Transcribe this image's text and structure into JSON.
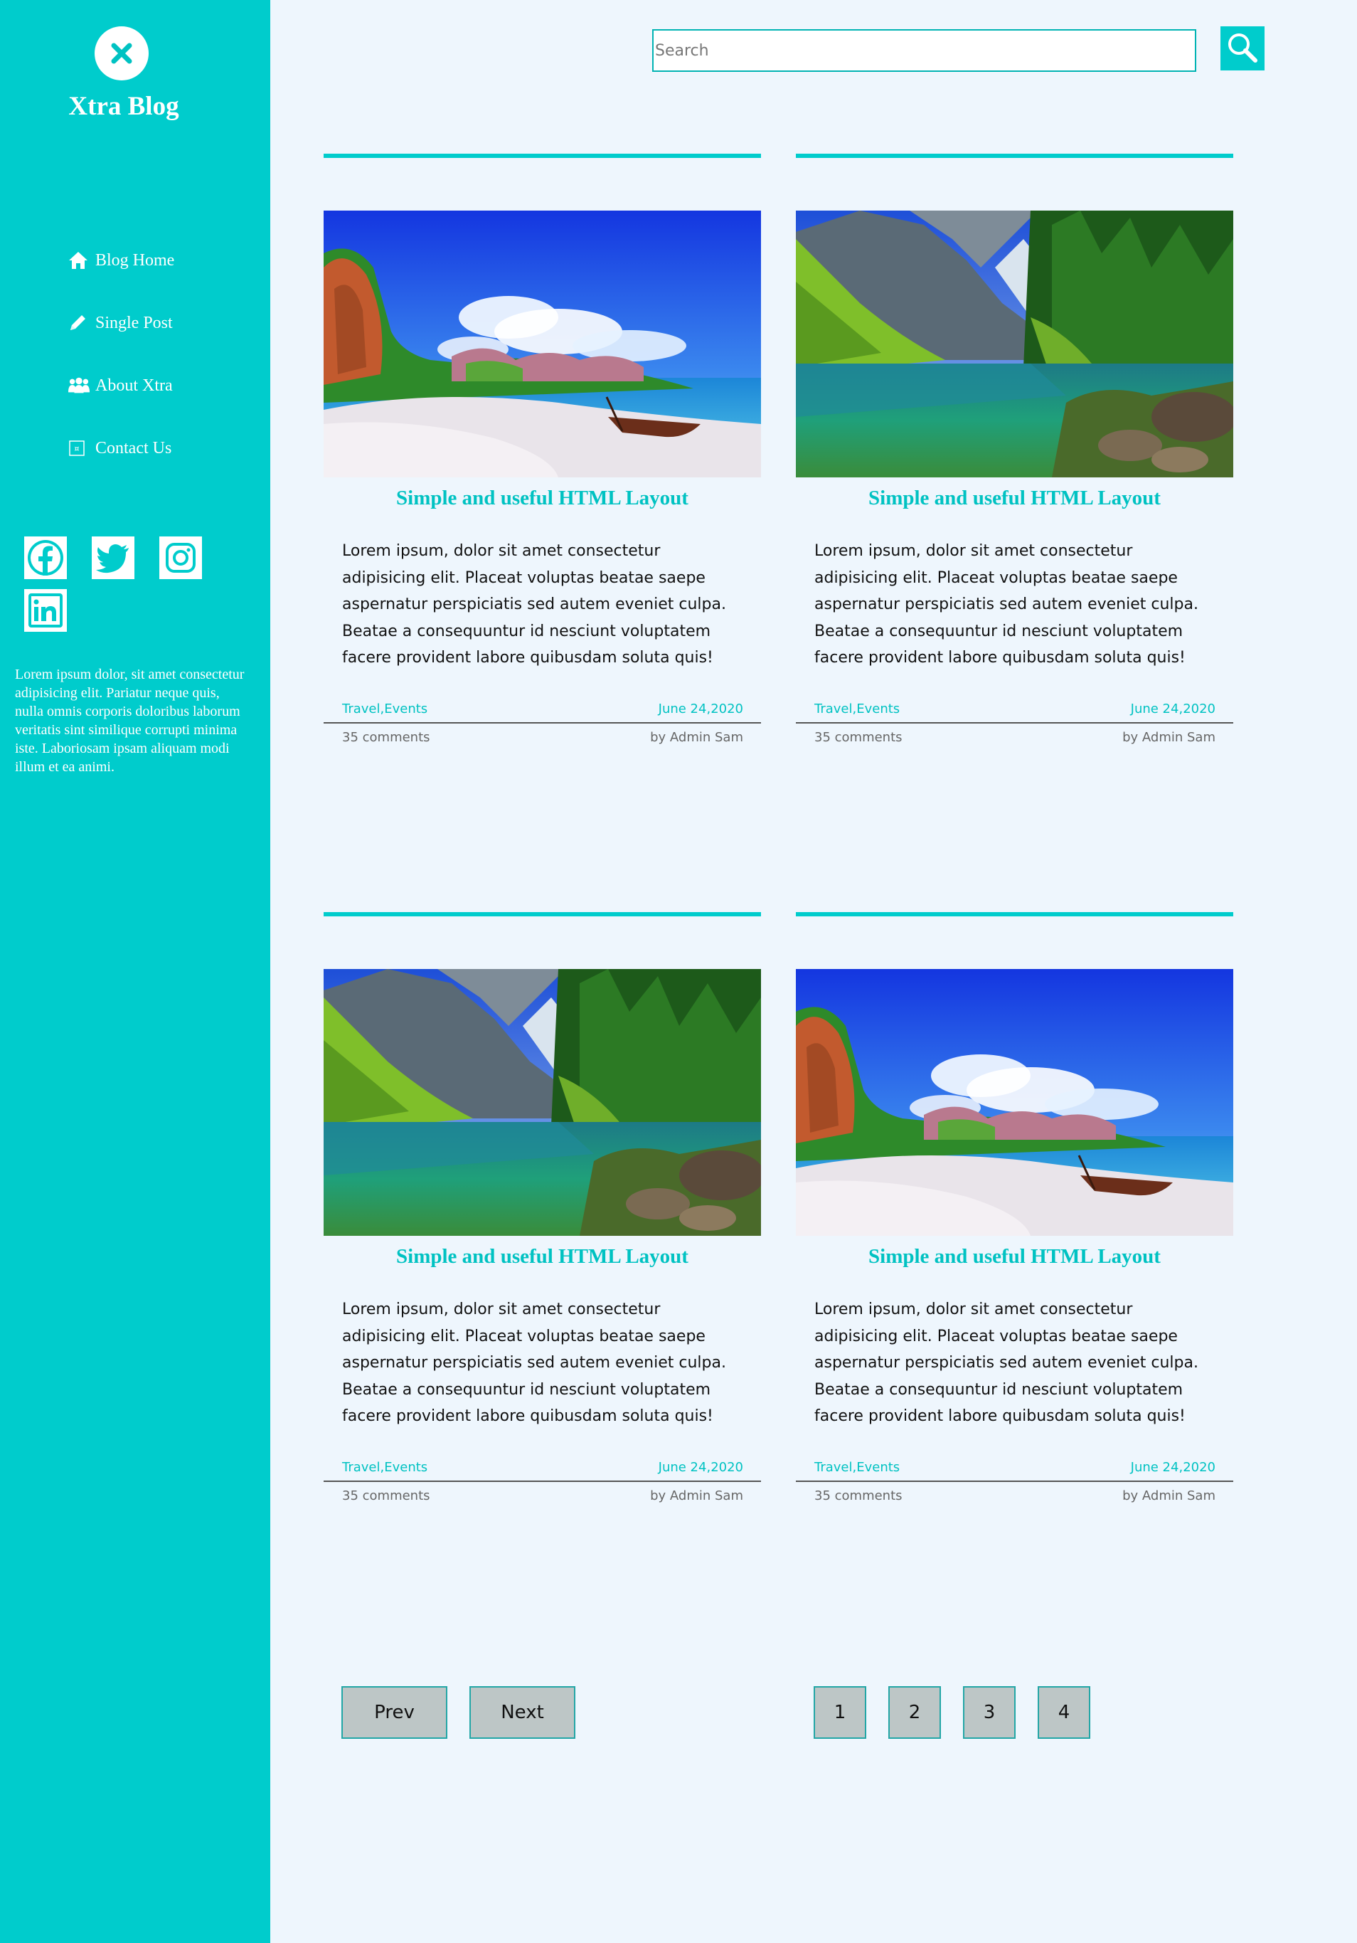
{
  "sidebar": {
    "brand": "Xtra Blog",
    "nav": [
      {
        "label": "Blog Home",
        "icon": "home-icon"
      },
      {
        "label": "Single Post",
        "icon": "pencil-icon"
      },
      {
        "label": "About Xtra",
        "icon": "users-icon"
      },
      {
        "label": "Contact Us",
        "icon": "contact-icon"
      }
    ],
    "socials": [
      "facebook-icon",
      "twitter-icon",
      "instagram-icon",
      "linkedin-icon"
    ],
    "text": "Lorem ipsum dolor, sit amet consectetur adipisicing elit. Pariatur neque quis, nulla omnis corporis doloribus laborum veritatis sint similique corrupti minima iste. Laboriosam ipsam aliquam modi illum et ea animi."
  },
  "search": {
    "placeholder": "Search",
    "button_icon": "search-icon"
  },
  "colors": {
    "accent": "#00cccc",
    "background": "#eef6fd",
    "button": "#bdc6c6"
  },
  "posts": [
    {
      "image": "beach",
      "title": "Simple and useful HTML Layout",
      "body": "Lorem ipsum, dolor sit amet consectetur adipisicing elit. Placeat voluptas beatae saepe aspernatur perspiciatis sed autem eveniet culpa. Beatae a consequuntur id nesciunt voluptatem facere provident labore quibusdam soluta quis!",
      "categories": "Travel,Events",
      "date": "June 24,2020",
      "comments": "35 comments",
      "author": "by Admin Sam"
    },
    {
      "image": "lake",
      "title": "Simple and useful HTML Layout",
      "body": "Lorem ipsum, dolor sit amet consectetur adipisicing elit. Placeat voluptas beatae saepe aspernatur perspiciatis sed autem eveniet culpa. Beatae a consequuntur id nesciunt voluptatem facere provident labore quibusdam soluta quis!",
      "categories": "Travel,Events",
      "date": "June 24,2020",
      "comments": "35 comments",
      "author": "by Admin Sam"
    },
    {
      "image": "lake",
      "title": "Simple and useful HTML Layout",
      "body": "Lorem ipsum, dolor sit amet consectetur adipisicing elit. Placeat voluptas beatae saepe aspernatur perspiciatis sed autem eveniet culpa. Beatae a consequuntur id nesciunt voluptatem facere provident labore quibusdam soluta quis!",
      "categories": "Travel,Events",
      "date": "June 24,2020",
      "comments": "35 comments",
      "author": "by Admin Sam"
    },
    {
      "image": "beach",
      "title": "Simple and useful HTML Layout",
      "body": "Lorem ipsum, dolor sit amet consectetur adipisicing elit. Placeat voluptas beatae saepe aspernatur perspiciatis sed autem eveniet culpa. Beatae a consequuntur id nesciunt voluptatem facere provident labore quibusdam soluta quis!",
      "categories": "Travel,Events",
      "date": "June 24,2020",
      "comments": "35 comments",
      "author": "by Admin Sam"
    }
  ],
  "pagination": {
    "prev": "Prev",
    "next": "Next",
    "pages": [
      "1",
      "2",
      "3",
      "4"
    ]
  }
}
